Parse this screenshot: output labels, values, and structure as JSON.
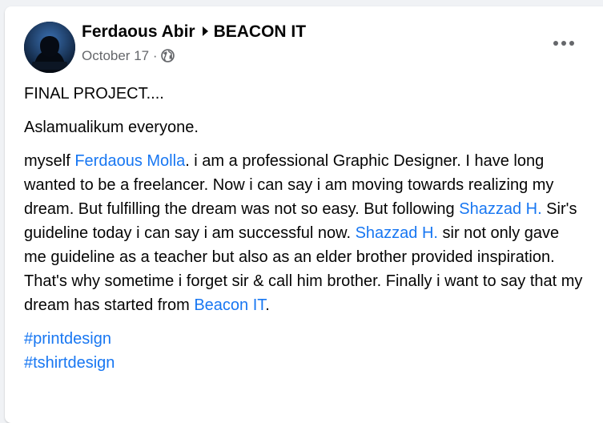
{
  "post": {
    "author": "Ferdaous Abir",
    "group": "BEACON IT",
    "date": "October 17",
    "separator": "·",
    "privacy_icon": "globe-icon",
    "more_icon": "more-options-icon",
    "title": "FINAL PROJECT....",
    "greeting": "Aslamualikum everyone.",
    "body": {
      "t1": "myself ",
      "mention1": "Ferdaous Molla",
      "t2": ". i am a professional Graphic Designer. I have long wanted to be a freelancer. Now i can say i am moving towards realizing my dream. But fulfilling the dream was not so easy. But following ",
      "mention2": "Shazzad H.",
      "t3": " Sir's guideline today i can say i am successful now. ",
      "mention3": "Shazzad H.",
      "t4": " sir not only gave me guideline as a teacher but also as an elder brother provided inspiration. That's why sometime i forget sir & call him brother. Finally i want to say that my dream has started from ",
      "mention4": "Beacon IT",
      "t5": "."
    },
    "hashtags": [
      "#printdesign",
      "#tshirtdesign"
    ]
  },
  "colors": {
    "link": "#1877f2",
    "text": "#050505",
    "secondary": "#65676b",
    "background": "#f0f2f5"
  }
}
